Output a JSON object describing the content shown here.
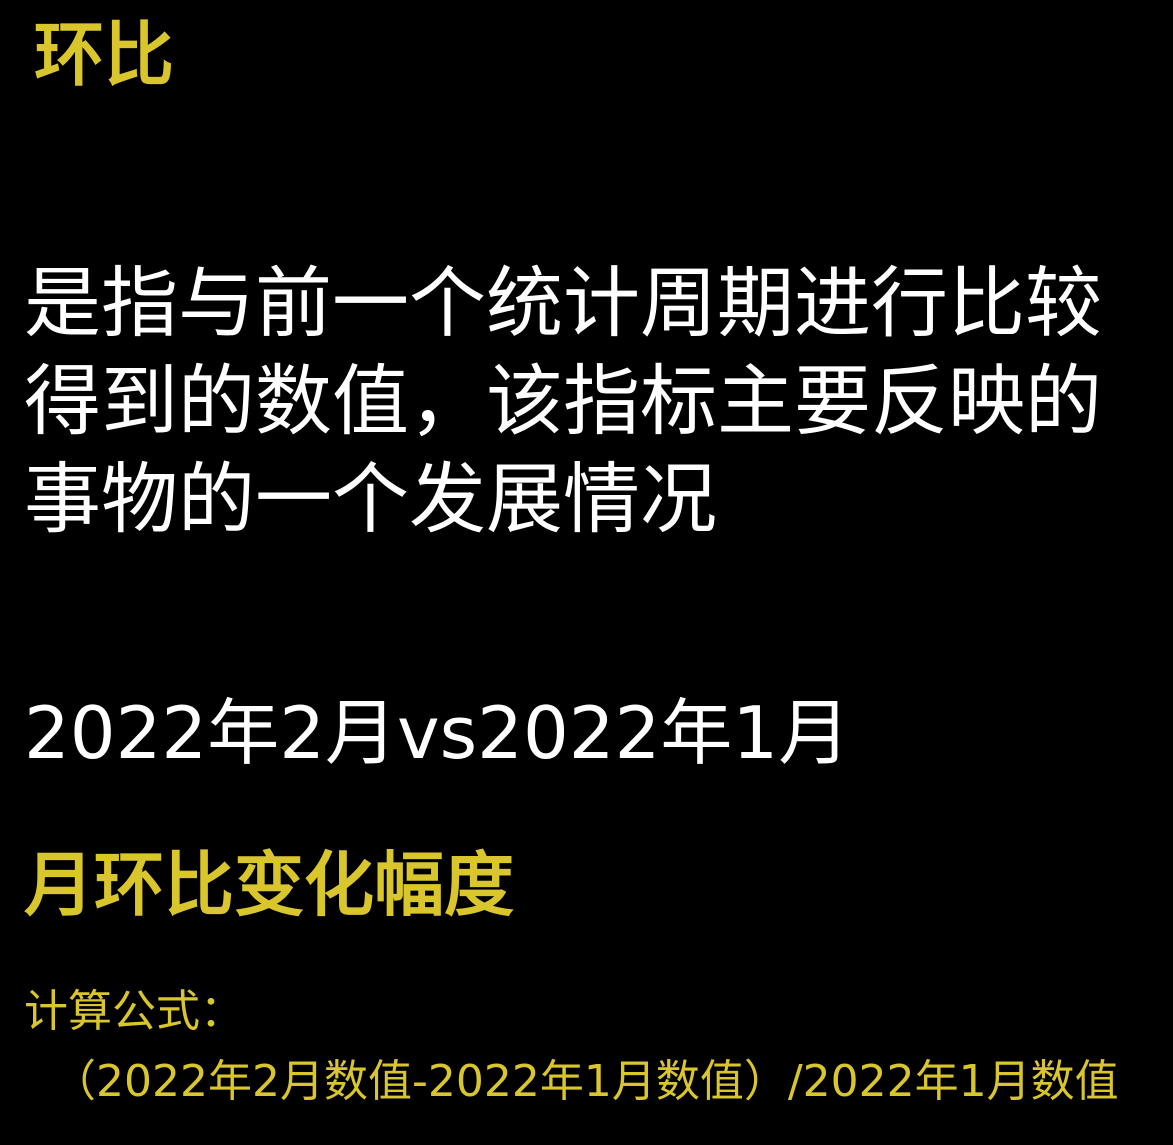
{
  "title": "环比",
  "definition_lines": [
    "是指与前一个统计周期进行比较",
    "得到的数值，该指标主要反映的",
    "事物的一个发展情况"
  ],
  "comparison": "2022年2月vs2022年1月",
  "subtitle": "月环比变化幅度",
  "formula_label": "计算公式：",
  "formula": "（2022年2月数值-2022年1月数值）/2022年1月数值",
  "colors": {
    "background": "#000000",
    "accent": "#d9c62c",
    "body_text": "#ffffff"
  }
}
